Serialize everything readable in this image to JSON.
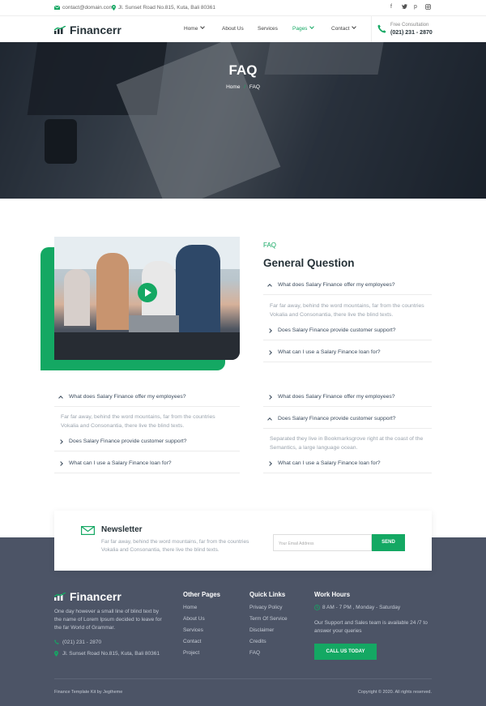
{
  "topbar": {
    "email": "contact@domain.com",
    "address": "Jl. Sunset Road No.815, Kuta, Bali 80361",
    "social": [
      "f",
      "t",
      "p",
      "ig"
    ]
  },
  "header": {
    "brand": "Financerr",
    "nav": {
      "home": "Home",
      "about": "About Us",
      "services": "Services",
      "pages": "Pages",
      "contact": "Contact"
    },
    "consult_label": "Free Consultation",
    "consult_phone": "(021) 231 - 2870"
  },
  "hero": {
    "title": "FAQ",
    "crumb_home": "Home",
    "crumb_sep": "/",
    "crumb_current": "FAQ"
  },
  "faq_main": {
    "tag": "FAQ",
    "title": "General Question",
    "items": [
      {
        "q": "What does Salary Finance offer my employees?",
        "a": "Far far away, behind the word mountains, far from the countries Vokalia and Consonantia, there live the blind texts.",
        "open": true
      },
      {
        "q": "Does Salary Finance provide customer support?",
        "open": false
      },
      {
        "q": "What can I use a Salary Finance loan for?",
        "open": false
      }
    ]
  },
  "faq_left": {
    "items": [
      {
        "q": "What does Salary Finance offer my employees?",
        "a": "Far far away, behind the word mountains, far from the countries Vokalia and Consonantia, there live the blind texts.",
        "open": true
      },
      {
        "q": "Does Salary Finance provide customer support?",
        "open": false
      },
      {
        "q": "What can I use a Salary Finance loan for?",
        "open": false
      }
    ]
  },
  "faq_right": {
    "items": [
      {
        "q": "What does Salary Finance offer my employees?",
        "open": false
      },
      {
        "q": "Does Salary Finance provide customer support?",
        "a": "Separated they live in Bookmarksgrove right at the coast of the Semantics, a large language ocean.",
        "open": true
      },
      {
        "q": "What can I use a Salary Finance loan for?",
        "open": false
      }
    ]
  },
  "newsletter": {
    "title": "Newsletter",
    "text": "Far far away, behind the word mountains, far from the countries Vokalia and Consonantia, there live the blind texts.",
    "placeholder": "Your Email Address",
    "button": "SEND"
  },
  "footer": {
    "brand": "Financerr",
    "about": "One day however a small line of blind text by the name of Lorem Ipsum decided to leave for the far World of Grammar.",
    "phone": "(021) 231 - 2870",
    "address": "Jl. Sunset Road No.815, Kuta, Bali 80361",
    "other_pages": {
      "title": "Other Pages",
      "links": [
        "Home",
        "About Us",
        "Services",
        "Contact",
        "Project"
      ]
    },
    "quick_links": {
      "title": "Quick Links",
      "links": [
        "Privacy Policy",
        "Term Of Service",
        "Disclaimer",
        "Credits",
        "FAQ"
      ]
    },
    "work_hours": {
      "title": "Work Hours",
      "hours": "8 AM - 7 PM , Monday - Saturday",
      "note": "Our Support and Sales team is available 24 /7 to answer your queries",
      "cta": "CALL US TODAY"
    },
    "credit": "Finance Template Kit by Jegtheme",
    "copyright": "Copyright © 2020. All rights reserved."
  },
  "colors": {
    "accent": "#14a863",
    "footer_bg": "#4c5466",
    "heading": "#263238"
  }
}
